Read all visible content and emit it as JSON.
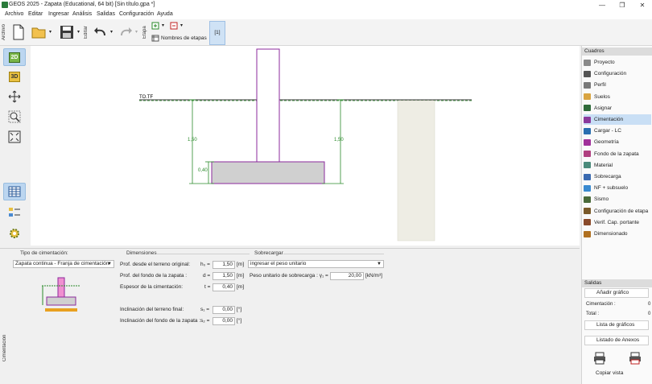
{
  "window": {
    "title": "GEOS 2025 - Zapata (Educational, 64 bit) [Sin título.gpa *]",
    "minimize": "—",
    "restore": "❐",
    "close": "✕"
  },
  "menu": [
    "Archivo",
    "Editar",
    "Ingresar",
    "Análisis",
    "Salidas",
    "Configuración",
    "Ayuda"
  ],
  "toolbar": {
    "archivo_label": "Archivo",
    "editar_label": "Editar",
    "etapa_label": "Etapa",
    "stage_names": "Nombres de etapas",
    "stage_tab": "[1]"
  },
  "leftbar": {
    "view2d": "2D",
    "view3d": "3D",
    "vertical_label": "Cimentación"
  },
  "drawing": {
    "terrain_label": "TO.TF",
    "dim_depth_left": "1,50",
    "dim_depth_right": "1,50",
    "dim_thickness": "0,40"
  },
  "cuadros": {
    "header": "Cuadros",
    "items": [
      {
        "label": "Proyecto",
        "color": "#8a8a8a"
      },
      {
        "label": "Configuración",
        "color": "#555555"
      },
      {
        "label": "Perfil",
        "color": "#7a7a7a"
      },
      {
        "label": "Suelos",
        "color": "#d9a441"
      },
      {
        "label": "Asignar",
        "color": "#2f6b3a"
      },
      {
        "label": "Cimentación",
        "color": "#8b3a9c",
        "active": true
      },
      {
        "label": "Cargar - LC",
        "color": "#2a6fb0"
      },
      {
        "label": "Geometría",
        "color": "#a0309a"
      },
      {
        "label": "Fondo de la zapata",
        "color": "#b04080"
      },
      {
        "label": "Material",
        "color": "#4a8a7a"
      },
      {
        "label": "Sobrecarga",
        "color": "#3a6ab0"
      },
      {
        "label": "NF + subsuelo",
        "color": "#3a8ad0"
      },
      {
        "label": "Sismo",
        "color": "#4a6a3a"
      },
      {
        "label": "Configuración de etapa",
        "color": "#7a5a2a"
      },
      {
        "label": "Verif. Cap. portante",
        "color": "#8a4a2a"
      },
      {
        "label": "Dimensionado",
        "color": "#b07020"
      }
    ]
  },
  "salidas": {
    "header": "Salidas",
    "add_graphic": "Añadir gráfico",
    "cimentacion_label": "Cimentación :",
    "cimentacion_value": "0",
    "total_label": "Total :",
    "total_value": "0",
    "graphics_list": "Lista de gráficos",
    "annex_list": "Listado de Anexos",
    "copy_view": "Copiar vista"
  },
  "form": {
    "foundation_type_title": "Tipo de cimentación:",
    "foundation_type_value": "Zapata continua - Franja de cimentación",
    "dimensions_title": "Dimensiones",
    "rows": [
      {
        "label": "Prof. desde el terreno original:",
        "sym": "h₀ =",
        "value": "1,50",
        "unit": "[m]"
      },
      {
        "label": "Prof. del fondo de la zapata :",
        "sym": "d =",
        "value": "1,50",
        "unit": "[m]"
      },
      {
        "label": "Espesor de la cimentación:",
        "sym": "t =",
        "value": "0,40",
        "unit": "[m]"
      },
      {
        "label": "Inclinación del terreno final:",
        "sym": "s₁ =",
        "value": "0,00",
        "unit": "[°]"
      },
      {
        "label": "Inclinación del fondo de la zapata :",
        "sym": "s₂ =",
        "value": "0,00",
        "unit": "[°]"
      }
    ],
    "surcharge_title": "Sobrecargar",
    "surcharge_mode": "ingresar el peso unitario",
    "surcharge_weight_label": "Peso unitario de sobrecarga : γ₁ =",
    "surcharge_weight_value": "20,00",
    "surcharge_weight_unit": "[kN/m³]"
  }
}
